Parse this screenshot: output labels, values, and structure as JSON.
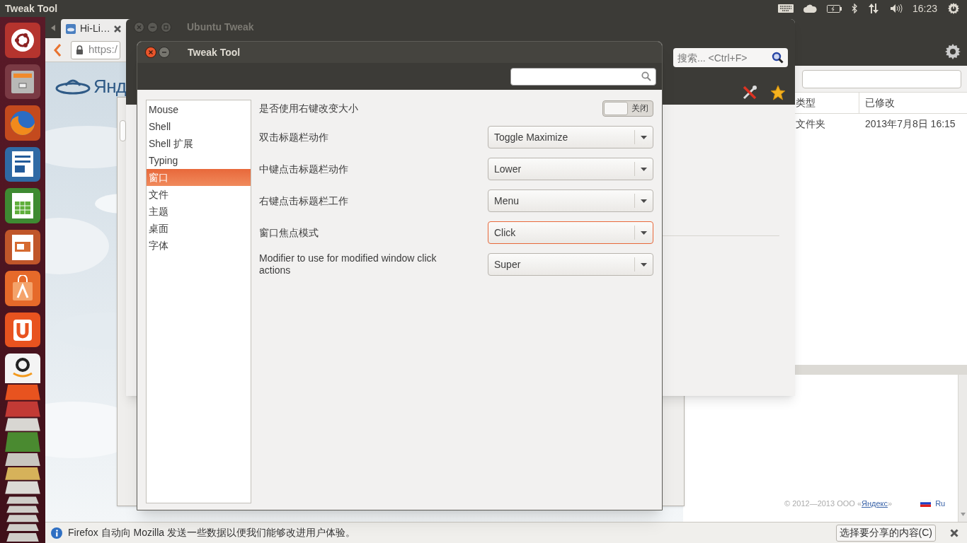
{
  "top_panel": {
    "app_title": "Tweak Tool",
    "clock": "16:23"
  },
  "browser": {
    "tab_title": "Hi-Li…",
    "url": "https:/",
    "logo_text": "Янд",
    "footer": {
      "copyright_start": "© 2012—2013 ООО «",
      "link": "Яндекс",
      "copyright_end": "»",
      "language": "Ru"
    },
    "notification": {
      "message": "Firefox 自动向 Mozilla 发送一些数据以便我们能够改进用户体验。",
      "button": "选择要分享的内容(C)"
    }
  },
  "file_manager": {
    "columns": [
      "类型",
      "已修改"
    ],
    "rows": [
      [
        "文件夹",
        "2013年7月8日 16:15"
      ]
    ]
  },
  "ubuntu_tweak": {
    "title": "Ubuntu Tweak",
    "search": {
      "placeholder": "搜索... <Ctrl+F>"
    }
  },
  "tweak_tool": {
    "title": "Tweak Tool",
    "sidebar": [
      {
        "label": "Mouse",
        "selected": false
      },
      {
        "label": "Shell",
        "selected": false
      },
      {
        "label": "Shell 扩展",
        "selected": false
      },
      {
        "label": "Typing",
        "selected": false
      },
      {
        "label": "窗口",
        "selected": true
      },
      {
        "label": "文件",
        "selected": false
      },
      {
        "label": "主题",
        "selected": false
      },
      {
        "label": "桌面",
        "selected": false
      },
      {
        "label": "字体",
        "selected": false
      }
    ],
    "settings": [
      {
        "kind": "switch",
        "label": "是否使用右键改变大小",
        "on": false,
        "state_text": "关闭"
      },
      {
        "kind": "dropdown",
        "label": "双击标题栏动作",
        "value": "Toggle Maximize",
        "focused": false
      },
      {
        "kind": "dropdown",
        "label": "中键点击标题栏动作",
        "value": "Lower",
        "focused": false
      },
      {
        "kind": "dropdown",
        "label": "右键点击标题栏工作",
        "value": "Menu",
        "focused": false
      },
      {
        "kind": "dropdown",
        "label": "窗口焦点模式",
        "value": "Click",
        "focused": true
      },
      {
        "kind": "dropdown",
        "label": "Modifier to use for modified window click actions",
        "value": "Super",
        "focused": false
      }
    ]
  }
}
